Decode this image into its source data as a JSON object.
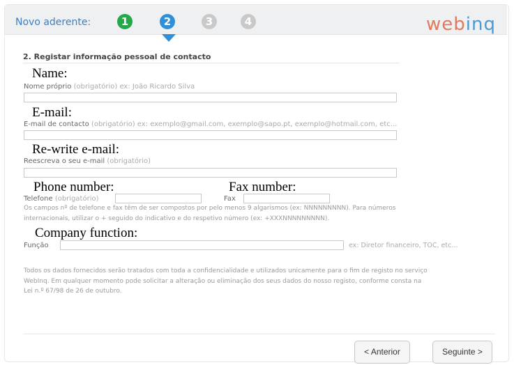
{
  "header": {
    "title": "Novo aderente:",
    "steps": [
      "1",
      "2",
      "3",
      "4"
    ],
    "logo_part1": "web",
    "logo_part2": "inq"
  },
  "section": {
    "title": "2. Registar informação pessoal de contacto"
  },
  "annotations": {
    "name": "Name:",
    "email": "E-mail:",
    "rewrite_email": "Re-write e-mail:",
    "phone": "Phone number:",
    "fax": "Fax number:",
    "company_function": "Company function:"
  },
  "form": {
    "name": {
      "label": "Nome próprio",
      "hint": "(obrigatório) ex: João Ricardo Silva",
      "value": ""
    },
    "email": {
      "label": "E-mail de contacto",
      "hint": "(obrigatório) ex: exemplo@gmail.com, exemplo@sapo.pt, exemplo@hotmail.com, etc...",
      "value": ""
    },
    "email_confirm": {
      "label": "Reescreva o seu e-mail",
      "hint": "(obrigatório)",
      "value": ""
    },
    "phone": {
      "label": "Telefone",
      "hint": "(obrigatório)",
      "value": ""
    },
    "fax": {
      "label": "Fax",
      "value": ""
    },
    "phone_note_line1": "Os campos nº de telefone e fax têm de ser compostos por pelo menos 9 algarismos (ex: NNNNNNNNN). Para números",
    "phone_note_line2": "internacionais, utilizar o + seguido do indicativo e do respetivo número (ex: +XXXNNNNNNNNN).",
    "function": {
      "label": "Função",
      "value": "",
      "example": "ex: Diretor financeiro, TOC, etc..."
    }
  },
  "privacy": {
    "line1": "Todos os dados fornecidos serão tratados com toda a confidencialidade e utilizados unicamente para o fim de registo no serviço",
    "line2": "WebInq. Em qualquer momento pode solicitar a alteração ou eliminação dos seus dados do nosso registo, conforme consta na",
    "line3": "Lei n.º 67/98 de 26 de outubro."
  },
  "buttons": {
    "previous": "< Anterior",
    "next": "Seguinte >"
  },
  "colors": {
    "header_title": "#3f7fc0",
    "step_done": "#23a84a",
    "step_active": "#2f8fd8",
    "step_todo": "#c9c9c9",
    "logo_primary": "#e07a5f",
    "logo_secondary": "#4a9ad6"
  }
}
